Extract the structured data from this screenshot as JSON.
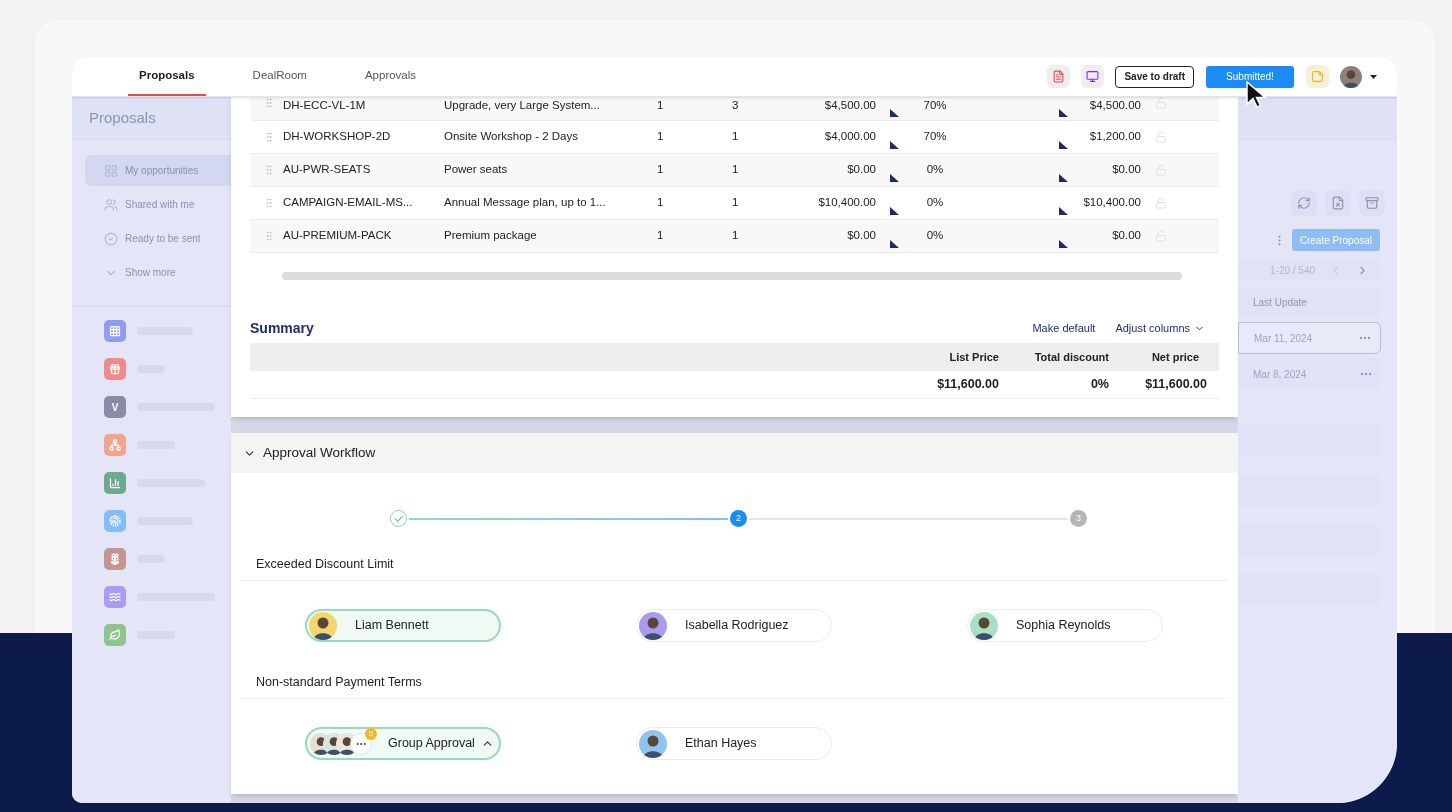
{
  "tabs": [
    {
      "label": "Proposals",
      "selected": true
    },
    {
      "label": "DealRoom",
      "selected": false
    },
    {
      "label": "Approvals",
      "selected": false
    }
  ],
  "actions": {
    "save_draft": "Save to draft",
    "submit": "Submitted!"
  },
  "sidebar": {
    "title": "Proposals",
    "items": [
      {
        "label": "My opportunities",
        "kind": "grid",
        "selected": true
      },
      {
        "label": "Shared with me",
        "kind": "people",
        "selected": false
      },
      {
        "label": "Ready to be sent",
        "kind": "check",
        "selected": false
      },
      {
        "label": "Show more",
        "kind": "chevron",
        "selected": false
      }
    ],
    "apps": [
      {
        "kind": "grid",
        "color": "#8e9cf2"
      },
      {
        "kind": "gift",
        "color": "#f08a8a"
      },
      {
        "kind": "letter",
        "label": "V",
        "color": "#8a8ca6"
      },
      {
        "kind": "network",
        "color": "#f0a58c"
      },
      {
        "kind": "chart",
        "color": "#6fa88e"
      },
      {
        "kind": "fingerprint",
        "color": "#86bdf6"
      },
      {
        "kind": "lotus",
        "color": "#c4968f"
      },
      {
        "kind": "waves",
        "color": "#a99cf2"
      },
      {
        "kind": "leaf",
        "color": "#8fc48f"
      }
    ]
  },
  "line_items": {
    "rows": [
      {
        "code": "DH-ECC-VL-1M",
        "description": "Upgrade, very Large System...",
        "column_3": "1",
        "column_4": "3",
        "price": "$4,500.00",
        "discount": "70%",
        "net": "$4,500.00"
      },
      {
        "code": "DH-WORKSHOP-2D",
        "description": "Onsite Workshop - 2 Days",
        "column_3": "1",
        "column_4": "1",
        "price": "$4,000.00",
        "discount": "70%",
        "net": "$1,200.00"
      },
      {
        "code": "AU-PWR-SEATS",
        "description": "Power seats",
        "column_3": "1",
        "column_4": "1",
        "price": "$0.00",
        "discount": "0%",
        "net": "$0.00"
      },
      {
        "code": "CAMPAIGN-EMAIL-MS...",
        "description": "Annual Message plan, up to 1...",
        "column_3": "1",
        "column_4": "1",
        "price": "$10,400.00",
        "discount": "0%",
        "net": "$10,400.00"
      },
      {
        "code": "AU-PREMIUM-PACK",
        "description": "Premium package",
        "column_3": "1",
        "column_4": "1",
        "price": "$0.00",
        "discount": "0%",
        "net": "$0.00"
      }
    ]
  },
  "summary": {
    "title": "Summary",
    "links": [
      {
        "label": "Make default",
        "kind": "plain"
      },
      {
        "label": "Adjust columns",
        "kind": "dropdown"
      }
    ],
    "columns": [
      "List Price",
      "Total discount",
      "Net price"
    ],
    "values": [
      "$11,600.00",
      "0%",
      "$11,600.00"
    ]
  },
  "workflow": {
    "title": "Approval Workflow",
    "expanded": true,
    "steps": [
      {
        "kind": "done"
      },
      {
        "kind": "current",
        "label": "2"
      },
      {
        "kind": "pending",
        "label": "3"
      }
    ],
    "sections": [
      {
        "title": "Exceeded Discount Limit",
        "approvers": [
          {
            "kind": "person",
            "name": "Liam Bennett",
            "approved": true,
            "color": "#f5d66b"
          },
          {
            "kind": "person",
            "name": "Isabella Rodriguez",
            "approved": false,
            "color": "#a99cf0"
          },
          {
            "kind": "person",
            "name": "Sophia Reynolds",
            "approved": false,
            "color": "#a8e0c4"
          }
        ]
      },
      {
        "title": "Non-standard Payment Terms",
        "approvers": [
          {
            "kind": "group",
            "name": "Group Approval",
            "approved": true,
            "expanded": true,
            "count": "5",
            "members": [
              {
                "color": "#e6ddd5"
              },
              {
                "color": "#d9e6dd"
              },
              {
                "color": "#ece6e0"
              }
            ]
          },
          {
            "kind": "person",
            "name": "Ethan Hayes",
            "approved": false,
            "color": "#8fc4f0"
          }
        ]
      }
    ]
  },
  "proposals_list": {
    "create_button": "Create Proposal",
    "pagination": "1-20 / 540",
    "column": "Last Update",
    "rows": [
      {
        "date": "Mar 11, 2024",
        "selected": true
      },
      {
        "date": "Mar 8, 2024",
        "selected": false
      }
    ]
  }
}
